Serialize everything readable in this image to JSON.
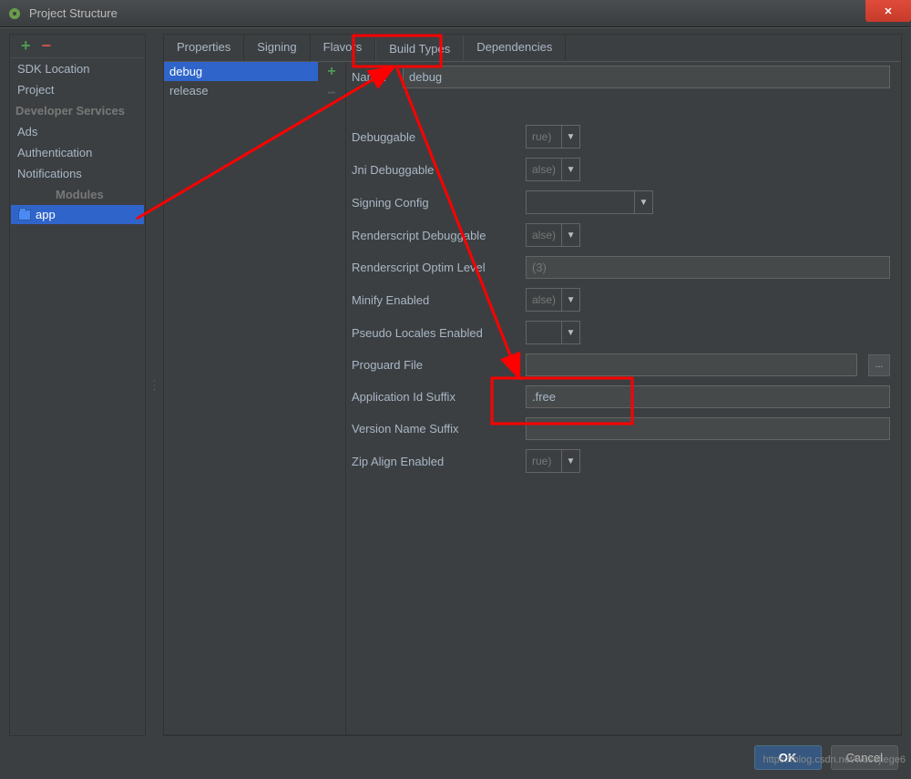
{
  "window": {
    "title": "Project Structure"
  },
  "sidebar": {
    "items": [
      "SDK Location",
      "Project"
    ],
    "dev_services_label": "Developer Services",
    "dev_items": [
      "Ads",
      "Authentication",
      "Notifications"
    ],
    "modules_label": "Modules",
    "selected_module": "app"
  },
  "tabs": [
    "Properties",
    "Signing",
    "Flavors",
    "Build Types",
    "Dependencies"
  ],
  "active_tab": "Build Types",
  "build_types": {
    "items": [
      "debug",
      "release"
    ],
    "selected": "debug"
  },
  "form": {
    "name_label": "Name:",
    "name_value": "debug",
    "debuggable_label": "Debuggable",
    "debuggable_value": "rue)",
    "jni_label": "Jni Debuggable",
    "jni_value": "alse)",
    "signing_label": "Signing Config",
    "signing_value": "",
    "rs_debug_label": "Renderscript Debuggable",
    "rs_debug_value": "alse)",
    "rs_optim_label": "Renderscript Optim Level",
    "rs_optim_value": "(3)",
    "minify_label": "Minify Enabled",
    "minify_value": "alse)",
    "pseudo_label": "Pseudo Locales Enabled",
    "pseudo_value": "",
    "proguard_label": "Proguard File",
    "proguard_value": "",
    "appid_label": "Application Id Suffix",
    "appid_value": ".free",
    "version_label": "Version Name Suffix",
    "version_value": "",
    "zip_label": "Zip Align Enabled",
    "zip_value": "rue)"
  },
  "buttons": {
    "ok": "OK",
    "cancel": "Cancel"
  },
  "watermark": "https://blog.csdn.net/wusejiege6",
  "annotation_color": "#ff0000"
}
